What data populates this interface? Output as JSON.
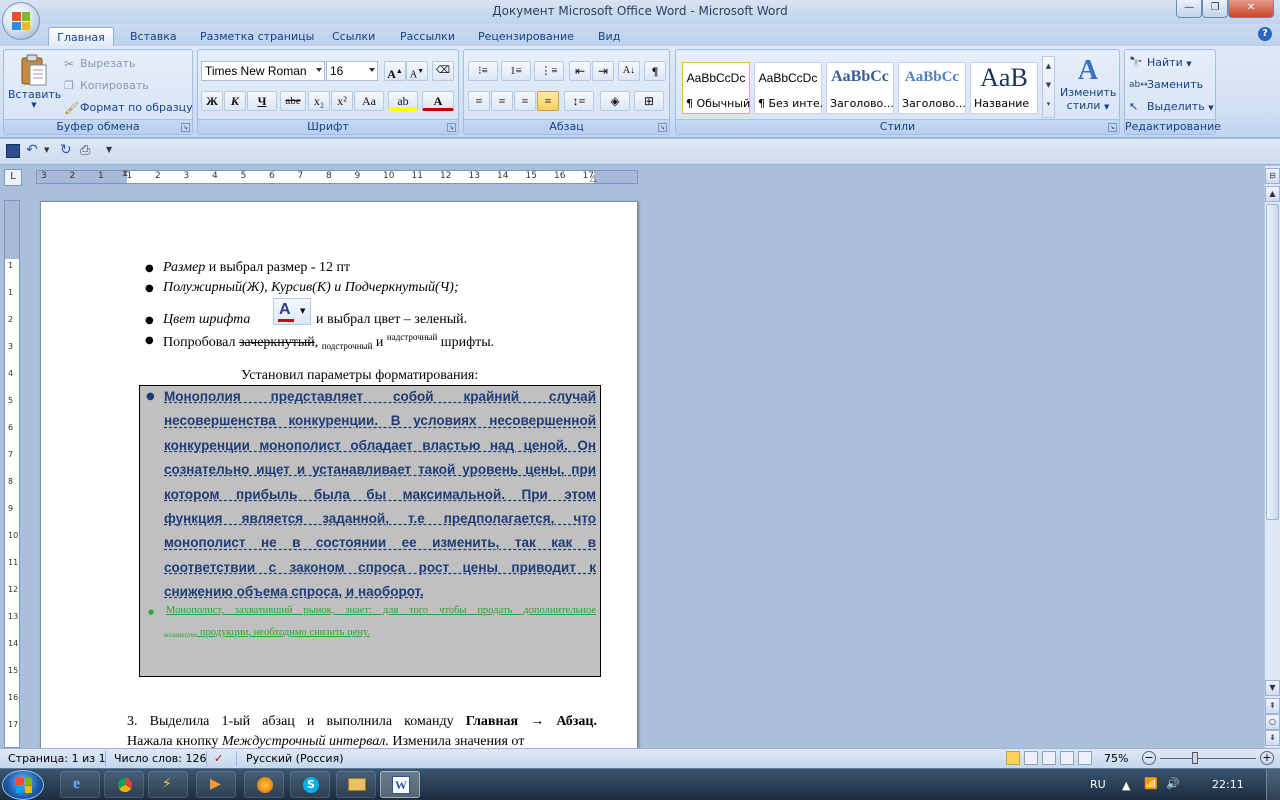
{
  "window": {
    "title": "Документ Microsoft Office Word - Microsoft Word"
  },
  "tabs": [
    "Главная",
    "Вставка",
    "Разметка страницы",
    "Ссылки",
    "Рассылки",
    "Рецензирование",
    "Вид"
  ],
  "clipboard": {
    "paste": "Вставить",
    "cut": "Вырезать",
    "copy": "Копировать",
    "format_painter": "Формат по образцу",
    "label": "Буфер обмена"
  },
  "font": {
    "name": "Times New Roman",
    "size": "16",
    "label": "Шрифт",
    "bold": "Ж",
    "italic": "К",
    "underline": "Ч",
    "strike": "abe",
    "sub": "x₂",
    "sup": "x²",
    "case": "Aa"
  },
  "paragraph": {
    "label": "Абзац"
  },
  "styles": {
    "label": "Стили",
    "items": [
      {
        "preview": "AaBbCcDc",
        "name": "¶ Обычный"
      },
      {
        "preview": "AaBbCcDc",
        "name": "¶ Без инте..."
      },
      {
        "preview": "AaBbCc",
        "name": "Заголово..."
      },
      {
        "preview": "AaBbCc",
        "name": "Заголово..."
      },
      {
        "preview": "AaB",
        "name": "Название"
      }
    ],
    "change_line1": "Изменить",
    "change_line2": "стили"
  },
  "editing": {
    "find": "Найти",
    "replace": "Заменить",
    "select": "Выделить",
    "label": "Редактирование"
  },
  "ruler": {
    "ticks": [
      "3",
      "2",
      "1",
      "1",
      "2",
      "3",
      "4",
      "5",
      "6",
      "7",
      "8",
      "9",
      "10",
      "11",
      "12",
      "13",
      "14",
      "15",
      "16",
      "17"
    ]
  },
  "vruler": {
    "ticks": [
      "1",
      "1",
      "2",
      "3",
      "4",
      "5",
      "6",
      "7",
      "8",
      "9",
      "10",
      "11",
      "12",
      "13",
      "14",
      "15",
      "16",
      "17"
    ]
  },
  "doc": {
    "b1_italic": "Размер",
    "b1_rest": " и выбрал размер - 12 пт",
    "b2": "Полужирный(Ж), Курсив(К) и Подчеркнутый(Ч);",
    "b3_italic": "Цвет шрифта",
    "b3_rest": " и выбрал цвет – зеленый.",
    "b4_a": "Попробовал ",
    "b4_strike": "зачеркнутый",
    "b4_b": ", ",
    "b4_sub": "подстрочный",
    "b4_c": " и ",
    "b4_sup": "надстрочный",
    "b4_d": " шрифты.",
    "heading": "Установил параметры форматирования:",
    "mono_lines": [
      "Монополия представляет собой крайний случай",
      "несовершенства конкуренции. В условиях несовершенной",
      "конкуренции монополист обладает властью над ценой. Он",
      "сознательно ищет и устанавливает такой уровень цены, при",
      "котором прибыль была бы максимальной. При этом",
      "функция является заданной, т.е предполагается, что",
      "монополист не в состоянии ее изменить, так как в",
      "соответствии с законом спроса рост цены приводит к",
      "снижению объема спроса, и наоборот."
    ],
    "green_line1": "Монополист, захвативший рынок, знает: для того чтобы продать дополнительное",
    "green_line2_a": "количество",
    "green_line2_b": " продукции, необходимо снизить цену.",
    "step3_a": "3. Выделила 1-ый абзац и выполнила команду ",
    "step3_b": "Главная → Абзац.",
    "step3_c": "Нажала кнопку ",
    "step3_d": "Междустрочный интервал.",
    "step3_e": " Изменила значения от"
  },
  "status": {
    "page": "Страница: 1 из 1",
    "words": "Число слов: 126",
    "lang": "Русский (Россия)",
    "zoom": "75%"
  },
  "tray": {
    "lang": "RU",
    "time": "22:11"
  }
}
